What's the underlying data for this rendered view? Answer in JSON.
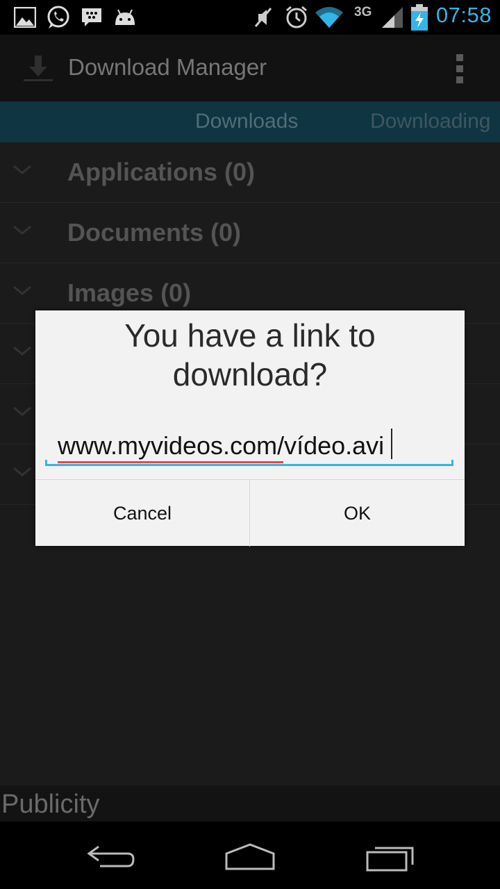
{
  "status_bar": {
    "time": "07:58",
    "network_type": "3G",
    "icons": [
      "gallery-icon",
      "whatsapp-icon",
      "bbm-icon",
      "android-icon",
      "mute-icon",
      "alarm-icon",
      "wifi-icon",
      "signal-icon",
      "battery-charging-icon"
    ],
    "accent_color": "#33b5e5"
  },
  "action_bar": {
    "title": "Download Manager",
    "app_icon": "download-icon",
    "overflow_icon": "overflow-menu-icon"
  },
  "tabs": [
    {
      "label": "Downloads"
    },
    {
      "label": "Downloading"
    }
  ],
  "categories": [
    {
      "label": "Applications (0)"
    },
    {
      "label": "Documents (0)"
    },
    {
      "label": "Images (0)"
    }
  ],
  "footer": {
    "publicity": "Publicity"
  },
  "dialog": {
    "title": "You have a link to download?",
    "url_value": "www.myvideos.com/vídeo.avi",
    "cancel_label": "Cancel",
    "ok_label": "OK"
  },
  "nav_bar": {
    "icons": [
      "back-icon",
      "home-icon",
      "recent-apps-icon"
    ]
  }
}
